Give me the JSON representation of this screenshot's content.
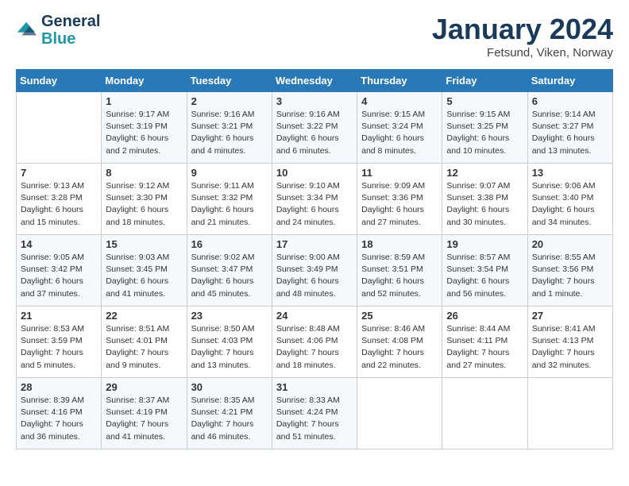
{
  "header": {
    "logo_line1": "General",
    "logo_line2": "Blue",
    "month": "January 2024",
    "location": "Fetsund, Viken, Norway"
  },
  "columns": [
    "Sunday",
    "Monday",
    "Tuesday",
    "Wednesday",
    "Thursday",
    "Friday",
    "Saturday"
  ],
  "weeks": [
    [
      {
        "day": "",
        "sunrise": "",
        "sunset": "",
        "daylight": ""
      },
      {
        "day": "1",
        "sunrise": "Sunrise: 9:17 AM",
        "sunset": "Sunset: 3:19 PM",
        "daylight": "Daylight: 6 hours and 2 minutes."
      },
      {
        "day": "2",
        "sunrise": "Sunrise: 9:16 AM",
        "sunset": "Sunset: 3:21 PM",
        "daylight": "Daylight: 6 hours and 4 minutes."
      },
      {
        "day": "3",
        "sunrise": "Sunrise: 9:16 AM",
        "sunset": "Sunset: 3:22 PM",
        "daylight": "Daylight: 6 hours and 6 minutes."
      },
      {
        "day": "4",
        "sunrise": "Sunrise: 9:15 AM",
        "sunset": "Sunset: 3:24 PM",
        "daylight": "Daylight: 6 hours and 8 minutes."
      },
      {
        "day": "5",
        "sunrise": "Sunrise: 9:15 AM",
        "sunset": "Sunset: 3:25 PM",
        "daylight": "Daylight: 6 hours and 10 minutes."
      },
      {
        "day": "6",
        "sunrise": "Sunrise: 9:14 AM",
        "sunset": "Sunset: 3:27 PM",
        "daylight": "Daylight: 6 hours and 13 minutes."
      }
    ],
    [
      {
        "day": "7",
        "sunrise": "Sunrise: 9:13 AM",
        "sunset": "Sunset: 3:28 PM",
        "daylight": "Daylight: 6 hours and 15 minutes."
      },
      {
        "day": "8",
        "sunrise": "Sunrise: 9:12 AM",
        "sunset": "Sunset: 3:30 PM",
        "daylight": "Daylight: 6 hours and 18 minutes."
      },
      {
        "day": "9",
        "sunrise": "Sunrise: 9:11 AM",
        "sunset": "Sunset: 3:32 PM",
        "daylight": "Daylight: 6 hours and 21 minutes."
      },
      {
        "day": "10",
        "sunrise": "Sunrise: 9:10 AM",
        "sunset": "Sunset: 3:34 PM",
        "daylight": "Daylight: 6 hours and 24 minutes."
      },
      {
        "day": "11",
        "sunrise": "Sunrise: 9:09 AM",
        "sunset": "Sunset: 3:36 PM",
        "daylight": "Daylight: 6 hours and 27 minutes."
      },
      {
        "day": "12",
        "sunrise": "Sunrise: 9:07 AM",
        "sunset": "Sunset: 3:38 PM",
        "daylight": "Daylight: 6 hours and 30 minutes."
      },
      {
        "day": "13",
        "sunrise": "Sunrise: 9:06 AM",
        "sunset": "Sunset: 3:40 PM",
        "daylight": "Daylight: 6 hours and 34 minutes."
      }
    ],
    [
      {
        "day": "14",
        "sunrise": "Sunrise: 9:05 AM",
        "sunset": "Sunset: 3:42 PM",
        "daylight": "Daylight: 6 hours and 37 minutes."
      },
      {
        "day": "15",
        "sunrise": "Sunrise: 9:03 AM",
        "sunset": "Sunset: 3:45 PM",
        "daylight": "Daylight: 6 hours and 41 minutes."
      },
      {
        "day": "16",
        "sunrise": "Sunrise: 9:02 AM",
        "sunset": "Sunset: 3:47 PM",
        "daylight": "Daylight: 6 hours and 45 minutes."
      },
      {
        "day": "17",
        "sunrise": "Sunrise: 9:00 AM",
        "sunset": "Sunset: 3:49 PM",
        "daylight": "Daylight: 6 hours and 48 minutes."
      },
      {
        "day": "18",
        "sunrise": "Sunrise: 8:59 AM",
        "sunset": "Sunset: 3:51 PM",
        "daylight": "Daylight: 6 hours and 52 minutes."
      },
      {
        "day": "19",
        "sunrise": "Sunrise: 8:57 AM",
        "sunset": "Sunset: 3:54 PM",
        "daylight": "Daylight: 6 hours and 56 minutes."
      },
      {
        "day": "20",
        "sunrise": "Sunrise: 8:55 AM",
        "sunset": "Sunset: 3:56 PM",
        "daylight": "Daylight: 7 hours and 1 minute."
      }
    ],
    [
      {
        "day": "21",
        "sunrise": "Sunrise: 8:53 AM",
        "sunset": "Sunset: 3:59 PM",
        "daylight": "Daylight: 7 hours and 5 minutes."
      },
      {
        "day": "22",
        "sunrise": "Sunrise: 8:51 AM",
        "sunset": "Sunset: 4:01 PM",
        "daylight": "Daylight: 7 hours and 9 minutes."
      },
      {
        "day": "23",
        "sunrise": "Sunrise: 8:50 AM",
        "sunset": "Sunset: 4:03 PM",
        "daylight": "Daylight: 7 hours and 13 minutes."
      },
      {
        "day": "24",
        "sunrise": "Sunrise: 8:48 AM",
        "sunset": "Sunset: 4:06 PM",
        "daylight": "Daylight: 7 hours and 18 minutes."
      },
      {
        "day": "25",
        "sunrise": "Sunrise: 8:46 AM",
        "sunset": "Sunset: 4:08 PM",
        "daylight": "Daylight: 7 hours and 22 minutes."
      },
      {
        "day": "26",
        "sunrise": "Sunrise: 8:44 AM",
        "sunset": "Sunset: 4:11 PM",
        "daylight": "Daylight: 7 hours and 27 minutes."
      },
      {
        "day": "27",
        "sunrise": "Sunrise: 8:41 AM",
        "sunset": "Sunset: 4:13 PM",
        "daylight": "Daylight: 7 hours and 32 minutes."
      }
    ],
    [
      {
        "day": "28",
        "sunrise": "Sunrise: 8:39 AM",
        "sunset": "Sunset: 4:16 PM",
        "daylight": "Daylight: 7 hours and 36 minutes."
      },
      {
        "day": "29",
        "sunrise": "Sunrise: 8:37 AM",
        "sunset": "Sunset: 4:19 PM",
        "daylight": "Daylight: 7 hours and 41 minutes."
      },
      {
        "day": "30",
        "sunrise": "Sunrise: 8:35 AM",
        "sunset": "Sunset: 4:21 PM",
        "daylight": "Daylight: 7 hours and 46 minutes."
      },
      {
        "day": "31",
        "sunrise": "Sunrise: 8:33 AM",
        "sunset": "Sunset: 4:24 PM",
        "daylight": "Daylight: 7 hours and 51 minutes."
      },
      {
        "day": "",
        "sunrise": "",
        "sunset": "",
        "daylight": ""
      },
      {
        "day": "",
        "sunrise": "",
        "sunset": "",
        "daylight": ""
      },
      {
        "day": "",
        "sunrise": "",
        "sunset": "",
        "daylight": ""
      }
    ]
  ]
}
